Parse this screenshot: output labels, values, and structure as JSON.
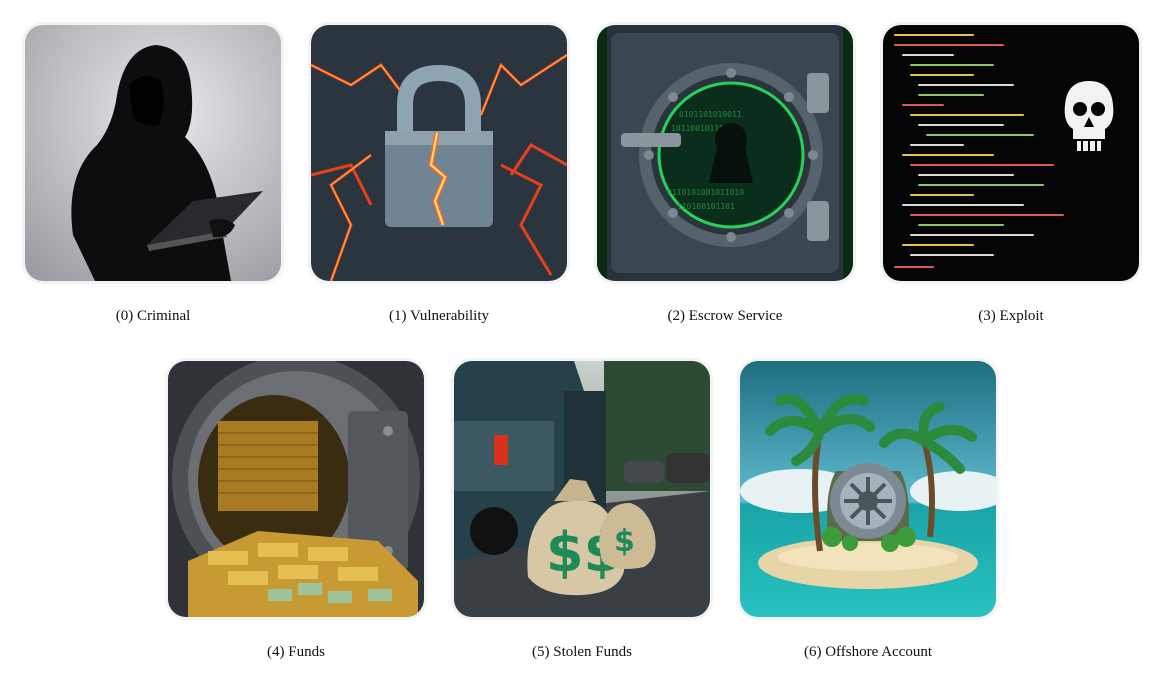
{
  "panels": [
    {
      "caption": "(0) Criminal",
      "icon": "hooded-hacker-icon"
    },
    {
      "caption": "(1) Vulnerability",
      "icon": "cracked-padlock-icon"
    },
    {
      "caption": "(2) Escrow Service",
      "icon": "digital-vault-door-icon"
    },
    {
      "caption": "(3) Exploit",
      "icon": "code-with-skull-icon"
    },
    {
      "caption": "(4) Funds",
      "icon": "gold-vault-icon"
    },
    {
      "caption": "(5) Stolen Funds",
      "icon": "money-bags-van-icon"
    },
    {
      "caption": "(6) Offshore Account",
      "icon": "island-vault-icon"
    }
  ]
}
